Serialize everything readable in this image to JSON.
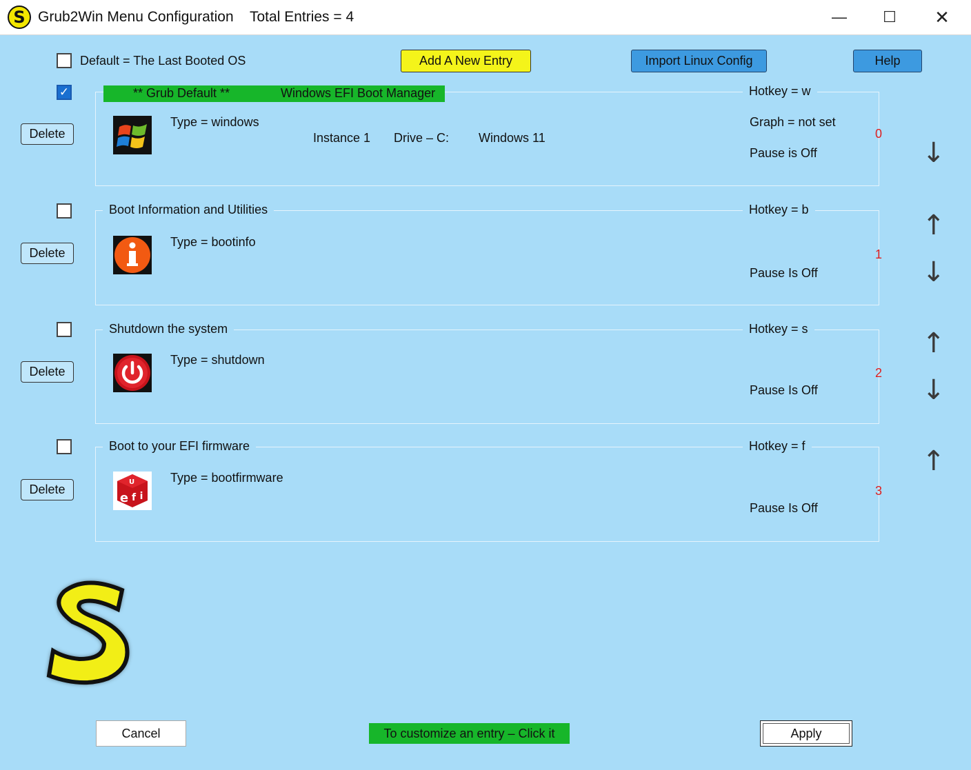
{
  "titlebar": {
    "app_icon_letter": "S",
    "title": "Grub2Win Menu Configuration",
    "entries": "Total Entries = 4",
    "minimize": "—",
    "maximize": "☐",
    "close": "✕"
  },
  "toolbar": {
    "default_checkbox_label": "Default = The Last Booted OS",
    "add_entry": "Add A New Entry",
    "import_linux": "Import Linux Config",
    "help": "Help"
  },
  "entries": [
    {
      "checked": true,
      "delete": "Delete",
      "default_marker": "** Grub Default **",
      "title": "Windows EFI Boot Manager",
      "hotkey": "Hotkey = w",
      "type": "Type = windows",
      "instance": "Instance 1",
      "drive": "Drive – C:",
      "os": "Windows 11",
      "graph": "Graph = not set",
      "pause": "Pause is Off",
      "index": "0",
      "icon": "windows-icon"
    },
    {
      "checked": false,
      "delete": "Delete",
      "title": "Boot Information and Utilities",
      "hotkey": "Hotkey = b",
      "type": "Type = bootinfo",
      "pause": "Pause Is Off",
      "index": "1",
      "icon": "info-icon"
    },
    {
      "checked": false,
      "delete": "Delete",
      "title": "Shutdown the system",
      "hotkey": "Hotkey = s",
      "type": "Type = shutdown",
      "pause": "Pause Is Off",
      "index": "2",
      "icon": "power-icon"
    },
    {
      "checked": false,
      "delete": "Delete",
      "title": "Boot to your EFI firmware",
      "hotkey": "Hotkey = f",
      "type": "Type = bootfirmware",
      "pause": "Pause Is Off",
      "index": "3",
      "icon": "uefi-icon"
    }
  ],
  "arrows": {
    "up": "↑",
    "down": "↓"
  },
  "footer": {
    "cancel": "Cancel",
    "hint": "To customize an entry – Click it",
    "apply": "Apply"
  },
  "colors": {
    "background": "#a8dcf8",
    "default_bar": "#17b62a",
    "add_button": "#f4f41a",
    "blue_button": "#3d9ae0",
    "index_red": "#e02020"
  }
}
